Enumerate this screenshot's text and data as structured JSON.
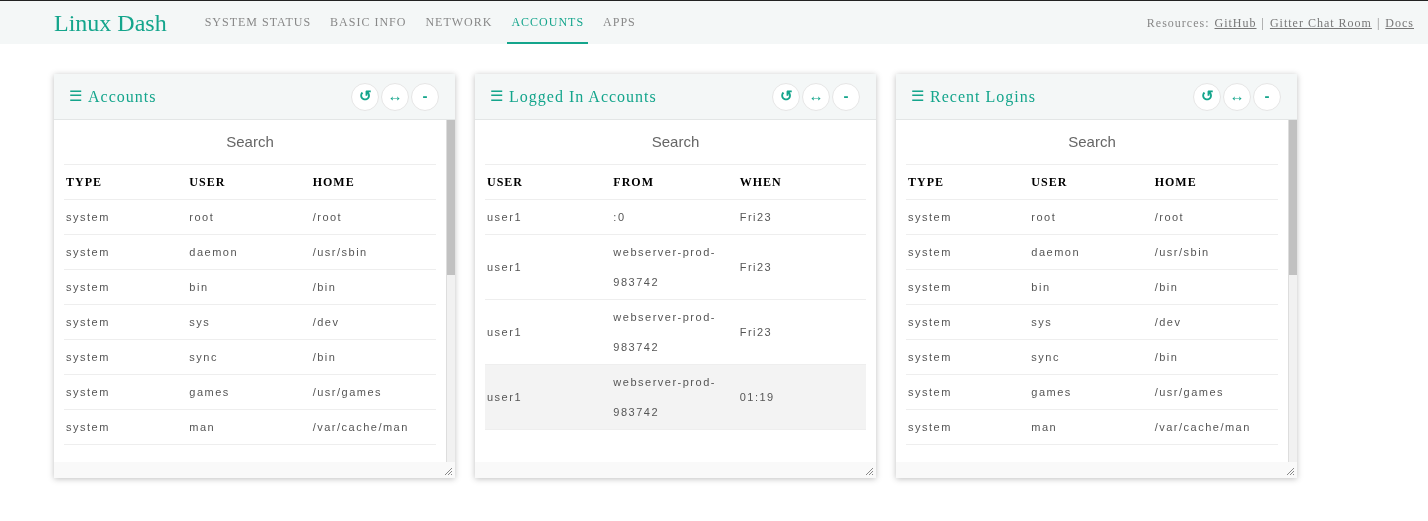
{
  "nav": {
    "logo": "Linux Dash",
    "tabs": [
      {
        "label": "SYSTEM STATUS",
        "selected": false
      },
      {
        "label": "BASIC INFO",
        "selected": false
      },
      {
        "label": "NETWORK",
        "selected": false
      },
      {
        "label": "ACCOUNTS",
        "selected": true
      },
      {
        "label": "APPS",
        "selected": false
      }
    ],
    "resources": {
      "label": "Resources:",
      "links": [
        "GitHub",
        "Gitter Chat Room",
        "Docs"
      ],
      "separator": "|"
    }
  },
  "widgets": [
    {
      "title": "Accounts",
      "menu_glyph": "☰",
      "buttons": [
        "↺",
        "↔",
        "-"
      ],
      "search_placeholder": "Search",
      "scrollable": true,
      "columns": [
        "TYPE",
        "USER",
        "HOME"
      ],
      "rows": [
        {
          "cells": [
            "system",
            "root",
            "/root"
          ],
          "highlighted": false
        },
        {
          "cells": [
            "system",
            "daemon",
            "/usr/sbin"
          ],
          "highlighted": false
        },
        {
          "cells": [
            "system",
            "bin",
            "/bin"
          ],
          "highlighted": false
        },
        {
          "cells": [
            "system",
            "sys",
            "/dev"
          ],
          "highlighted": false
        },
        {
          "cells": [
            "system",
            "sync",
            "/bin"
          ],
          "highlighted": false
        },
        {
          "cells": [
            "system",
            "games",
            "/usr/games"
          ],
          "highlighted": false
        },
        {
          "cells": [
            "system",
            "man",
            "/var/cache/man"
          ],
          "highlighted": false
        }
      ]
    },
    {
      "title": "Logged In Accounts",
      "menu_glyph": "☰",
      "buttons": [
        "↺",
        "↔",
        "-"
      ],
      "search_placeholder": "Search",
      "scrollable": false,
      "columns": [
        "USER",
        "FROM",
        "WHEN"
      ],
      "rows": [
        {
          "cells": [
            "user1",
            ":0",
            "Fri23"
          ],
          "highlighted": false
        },
        {
          "cells": [
            "user1",
            "webserver-prod-983742",
            "Fri23"
          ],
          "highlighted": false
        },
        {
          "cells": [
            "user1",
            "webserver-prod-983742",
            "Fri23"
          ],
          "highlighted": false
        },
        {
          "cells": [
            "user1",
            "webserver-prod-983742",
            "01:19"
          ],
          "highlighted": true
        }
      ]
    },
    {
      "title": "Recent Logins",
      "menu_glyph": "☰",
      "buttons": [
        "↺",
        "↔",
        "-"
      ],
      "search_placeholder": "Search",
      "scrollable": true,
      "columns": [
        "TYPE",
        "USER",
        "HOME"
      ],
      "rows": [
        {
          "cells": [
            "system",
            "root",
            "/root"
          ],
          "highlighted": false
        },
        {
          "cells": [
            "system",
            "daemon",
            "/usr/sbin"
          ],
          "highlighted": false
        },
        {
          "cells": [
            "system",
            "bin",
            "/bin"
          ],
          "highlighted": false
        },
        {
          "cells": [
            "system",
            "sys",
            "/dev"
          ],
          "highlighted": false
        },
        {
          "cells": [
            "system",
            "sync",
            "/bin"
          ],
          "highlighted": false
        },
        {
          "cells": [
            "system",
            "games",
            "/usr/games"
          ],
          "highlighted": false
        },
        {
          "cells": [
            "system",
            "man",
            "/var/cache/man"
          ],
          "highlighted": false
        }
      ]
    }
  ]
}
